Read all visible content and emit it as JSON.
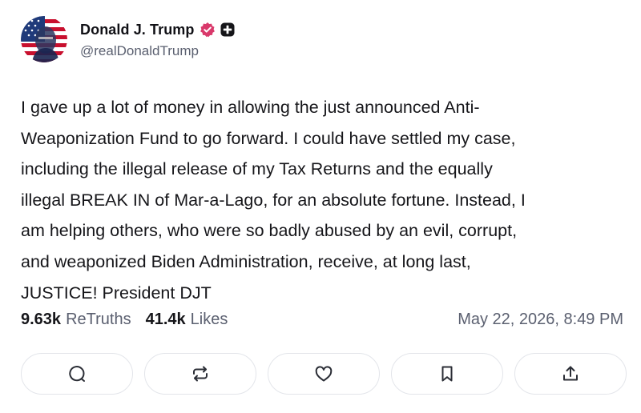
{
  "post": {
    "author": {
      "display_name": "Donald J. Trump",
      "handle": "@realDonaldTrump",
      "avatar_icon": "flag-portrait-avatar",
      "verified_icon": "verified-badge-icon",
      "verified_color": "#d9396b"
    },
    "text": "I gave up a lot of money in allowing the just announced Anti-\nWeaponization Fund to go forward. I could have settled my case,\nincluding the illegal release of my Tax Returns and the equally\nillegal BREAK IN of Mar-a-Lago, for an absolute fortune. Instead, I\nam helping others, who were so badly abused by an evil, corrupt,\nand weaponized Biden Administration, receive, at long last,\nJUSTICE! President DJT",
    "stats": {
      "retruths_count": "9.63k",
      "retruths_label": "ReTruths",
      "likes_count": "41.4k",
      "likes_label": "Likes"
    },
    "timestamp": "May 22, 2026, 8:49 PM",
    "actions": [
      {
        "name": "reply",
        "icon": "comment-icon"
      },
      {
        "name": "retruth",
        "icon": "repost-icon"
      },
      {
        "name": "like",
        "icon": "heart-icon"
      },
      {
        "name": "bookmark",
        "icon": "bookmark-icon"
      },
      {
        "name": "share",
        "icon": "share-icon"
      }
    ]
  }
}
